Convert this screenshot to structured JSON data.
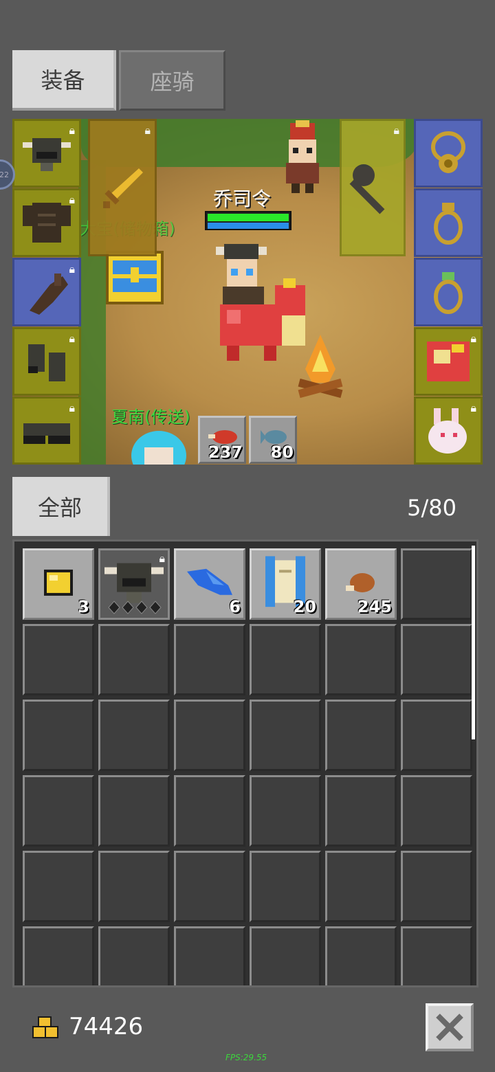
{
  "tabs": {
    "equipment": "装备",
    "mount": "座骑"
  },
  "scene": {
    "player_name": "乔司令",
    "npc_storage": "大宝(储物箱)",
    "npc_teleport": "夏南(传送)",
    "left_badge": "22"
  },
  "consumables": [
    {
      "icon": "meat-icon",
      "count": "237"
    },
    {
      "icon": "fish-icon",
      "count": "80"
    }
  ],
  "inventory": {
    "filter": "全部",
    "capacity": "5/80",
    "items": [
      {
        "icon": "gold-nugget-icon",
        "count": "3"
      },
      {
        "icon": "helmet-icon",
        "count": ""
      },
      {
        "icon": "feather-icon",
        "count": "6"
      },
      {
        "icon": "scroll-icon",
        "count": "20"
      },
      {
        "icon": "meat-icon",
        "count": "245"
      }
    ]
  },
  "footer": {
    "gold": "74426",
    "fps": "FPS:29.55"
  },
  "colors": {
    "olive_slot": "#8f8f18",
    "blue_slot": "#5566b8",
    "hp": "#2ae82a",
    "mp": "#2a8ee8"
  }
}
